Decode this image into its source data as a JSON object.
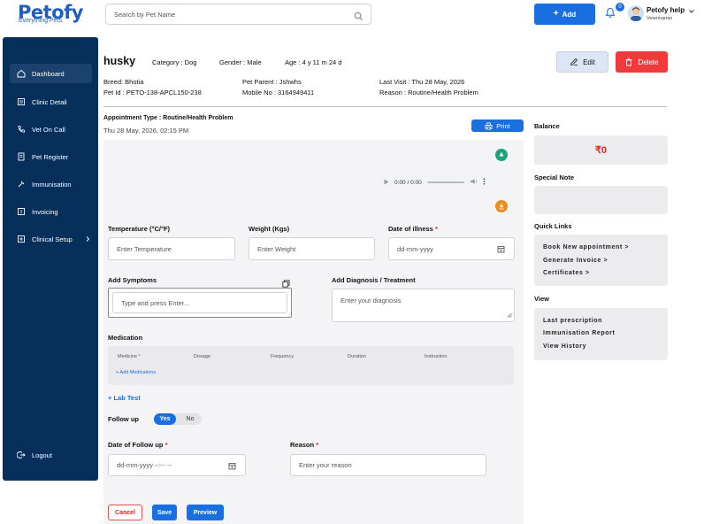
{
  "brand": {
    "name": "Petofy",
    "tagline": "Everything Pets"
  },
  "header": {
    "search_placeholder": "Search by Pet Name",
    "add_label": "Add",
    "notification_count": "0",
    "user_name": "Petofy help",
    "user_role": "Veterinarian"
  },
  "sidebar": {
    "items": [
      {
        "label": "Dashboard"
      },
      {
        "label": "Clinic Detail"
      },
      {
        "label": "Vet On Call"
      },
      {
        "label": "Pet Register"
      },
      {
        "label": "Immunisation"
      },
      {
        "label": "Invoicing"
      },
      {
        "label": "Clinical Setup"
      }
    ],
    "logout": "Logout"
  },
  "pet": {
    "name": "husky",
    "category": "Category : Dog",
    "gender": "Gender : Male",
    "age": "Age : 4 y 11 m 24 d",
    "breed": "Breed: Bhotia",
    "pet_id": "Pet Id : PETO-138-APCL150-238",
    "parent": "Pet Parent : Jshwhs",
    "mobile": "Mobile No : 3164949411",
    "last_visit": "Last Visit : Thu 28 May, 2026",
    "reason": "Reason : Routine/Health Problem"
  },
  "actions": {
    "edit": "Edit",
    "delete": "Delete",
    "print": "Print"
  },
  "appointment": {
    "type": "Appointment Type : Routine/Health Problem",
    "datetime": "Thu 28 May, 2026, 02:15 PM"
  },
  "audio": {
    "time": "0:00 / 0:00"
  },
  "form": {
    "temperature_label": "Temperature (°C/°F)",
    "temperature_placeholder": "Enter Temperature",
    "weight_label": "Weight (Kgs)",
    "weight_placeholder": "Enter Weight",
    "illness_label": "Date of illness",
    "illness_placeholder": "dd-mm-yyyy",
    "symptoms_label": "Add Symptoms",
    "symptoms_placeholder": "Type and press Enter...",
    "diagnosis_label": "Add Diagnosis / Treatment",
    "diagnosis_placeholder": "Enter your diagnosis",
    "medication_label": "Medication",
    "medication_columns": [
      "Medicine",
      "Dosage",
      "Frequency",
      "Duration",
      "Instruction"
    ],
    "add_medications": "+ Add Medications",
    "lab_test": "+ Lab Test",
    "follow_up_label": "Follow up",
    "follow_yes": "Yes",
    "follow_no": "No",
    "followup_date_label": "Date of Follow up",
    "followup_date_placeholder": "dd-mm-yyyy --:-- --",
    "reason_label": "Reason",
    "reason_placeholder": "Enter your reason",
    "required_mark": "*"
  },
  "buttons": {
    "cancel": "Cancel",
    "save": "Save",
    "preview": "Preview"
  },
  "right": {
    "balance_label": "Balance",
    "balance_value": "₹0",
    "special_note_label": "Special Note",
    "quick_links_label": "Quick Links",
    "quick_links": [
      "Book New appointment >",
      "Generate Invoice >",
      "Certificates >"
    ],
    "view_label": "View",
    "view_links": [
      "Last prescription",
      "Immunisation Report",
      "View History"
    ]
  },
  "colors": {
    "primary": "#1a6fe0",
    "sidebar": "#062f5b",
    "danger": "#ef3b3b",
    "success": "#1fa37a",
    "warning": "#f08c1b"
  }
}
